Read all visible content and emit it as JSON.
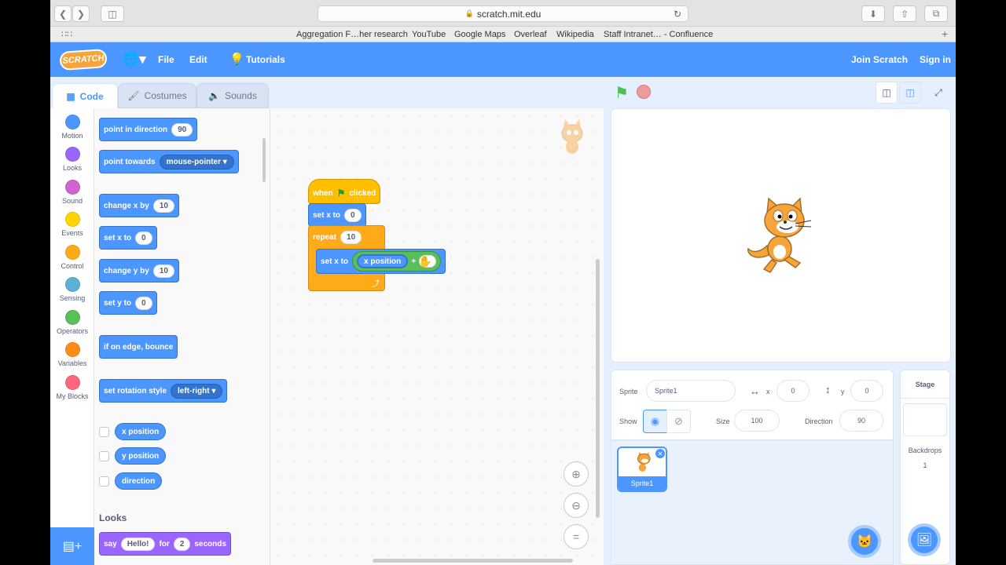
{
  "browser": {
    "url": "scratch.mit.edu",
    "bookmarks": [
      "Aggregation F…her research",
      "YouTube",
      "Google Maps",
      "Overleaf",
      "Wikipedia",
      "Staff Intranet… - Confluence"
    ]
  },
  "menu": {
    "logo": "SCRATCH",
    "file": "File",
    "edit": "Edit",
    "tutorials": "Tutorials",
    "join": "Join Scratch",
    "signin": "Sign in"
  },
  "tabs": {
    "code": "Code",
    "costumes": "Costumes",
    "sounds": "Sounds"
  },
  "categories": [
    {
      "label": "Motion",
      "color": "#4c97ff"
    },
    {
      "label": "Looks",
      "color": "#9966ff"
    },
    {
      "label": "Sound",
      "color": "#cf63cf"
    },
    {
      "label": "Events",
      "color": "#ffd500"
    },
    {
      "label": "Control",
      "color": "#ffab19"
    },
    {
      "label": "Sensing",
      "color": "#5cb1d6"
    },
    {
      "label": "Operators",
      "color": "#59c059"
    },
    {
      "label": "Variables",
      "color": "#ff8c1a"
    },
    {
      "label": "My Blocks",
      "color": "#ff6680"
    }
  ],
  "palette": {
    "point_dir": "point in direction",
    "point_dir_val": "90",
    "point_towards": "point towards",
    "point_towards_val": "mouse-pointer",
    "change_x": "change x by",
    "change_x_val": "10",
    "set_x": "set x to",
    "set_x_val": "0",
    "change_y": "change y by",
    "change_y_val": "10",
    "set_y": "set y to",
    "set_y_val": "0",
    "bounce": "if on edge, bounce",
    "rot_style": "set rotation style",
    "rot_style_val": "left-right",
    "rep_x": "x position",
    "rep_y": "y position",
    "rep_dir": "direction",
    "looks_heading": "Looks",
    "say": "say",
    "say_val": "Hello!",
    "say_for": "for",
    "say_secs": "2",
    "say_seconds": "seconds"
  },
  "script": {
    "when": "when",
    "clicked": "clicked",
    "set_x": "set x to",
    "set_x_val": "0",
    "repeat": "repeat",
    "repeat_val": "10",
    "inner_set_x": "set x to",
    "xpos": "x position",
    "plus": "+"
  },
  "sprite_info": {
    "sprite_label": "Sprite",
    "sprite_name": "Sprite1",
    "x_label": "x",
    "x_val": "0",
    "y_label": "y",
    "y_val": "0",
    "show_label": "Show",
    "size_label": "Size",
    "size_val": "100",
    "direction_label": "Direction",
    "direction_val": "90"
  },
  "sprite_list": [
    {
      "name": "Sprite1"
    }
  ],
  "stage_panel": {
    "title": "Stage",
    "backdrops_label": "Backdrops",
    "backdrops_count": "1"
  }
}
